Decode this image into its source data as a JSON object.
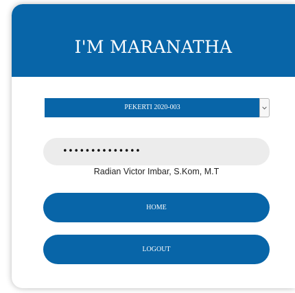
{
  "header": {
    "title": "I'M MARANATHA"
  },
  "course_select": {
    "selected": "PEKERTI 2020-003",
    "arrow_icon": "chevron-down-icon"
  },
  "password": {
    "value": "••••••••••••••"
  },
  "user": {
    "name": "Radian Victor Imbar, S.Kom, M.T"
  },
  "buttons": {
    "home": "HOME",
    "logout": "LOGOUT"
  },
  "colors": {
    "brand": "#0865a8",
    "input_bg": "#ececec"
  }
}
